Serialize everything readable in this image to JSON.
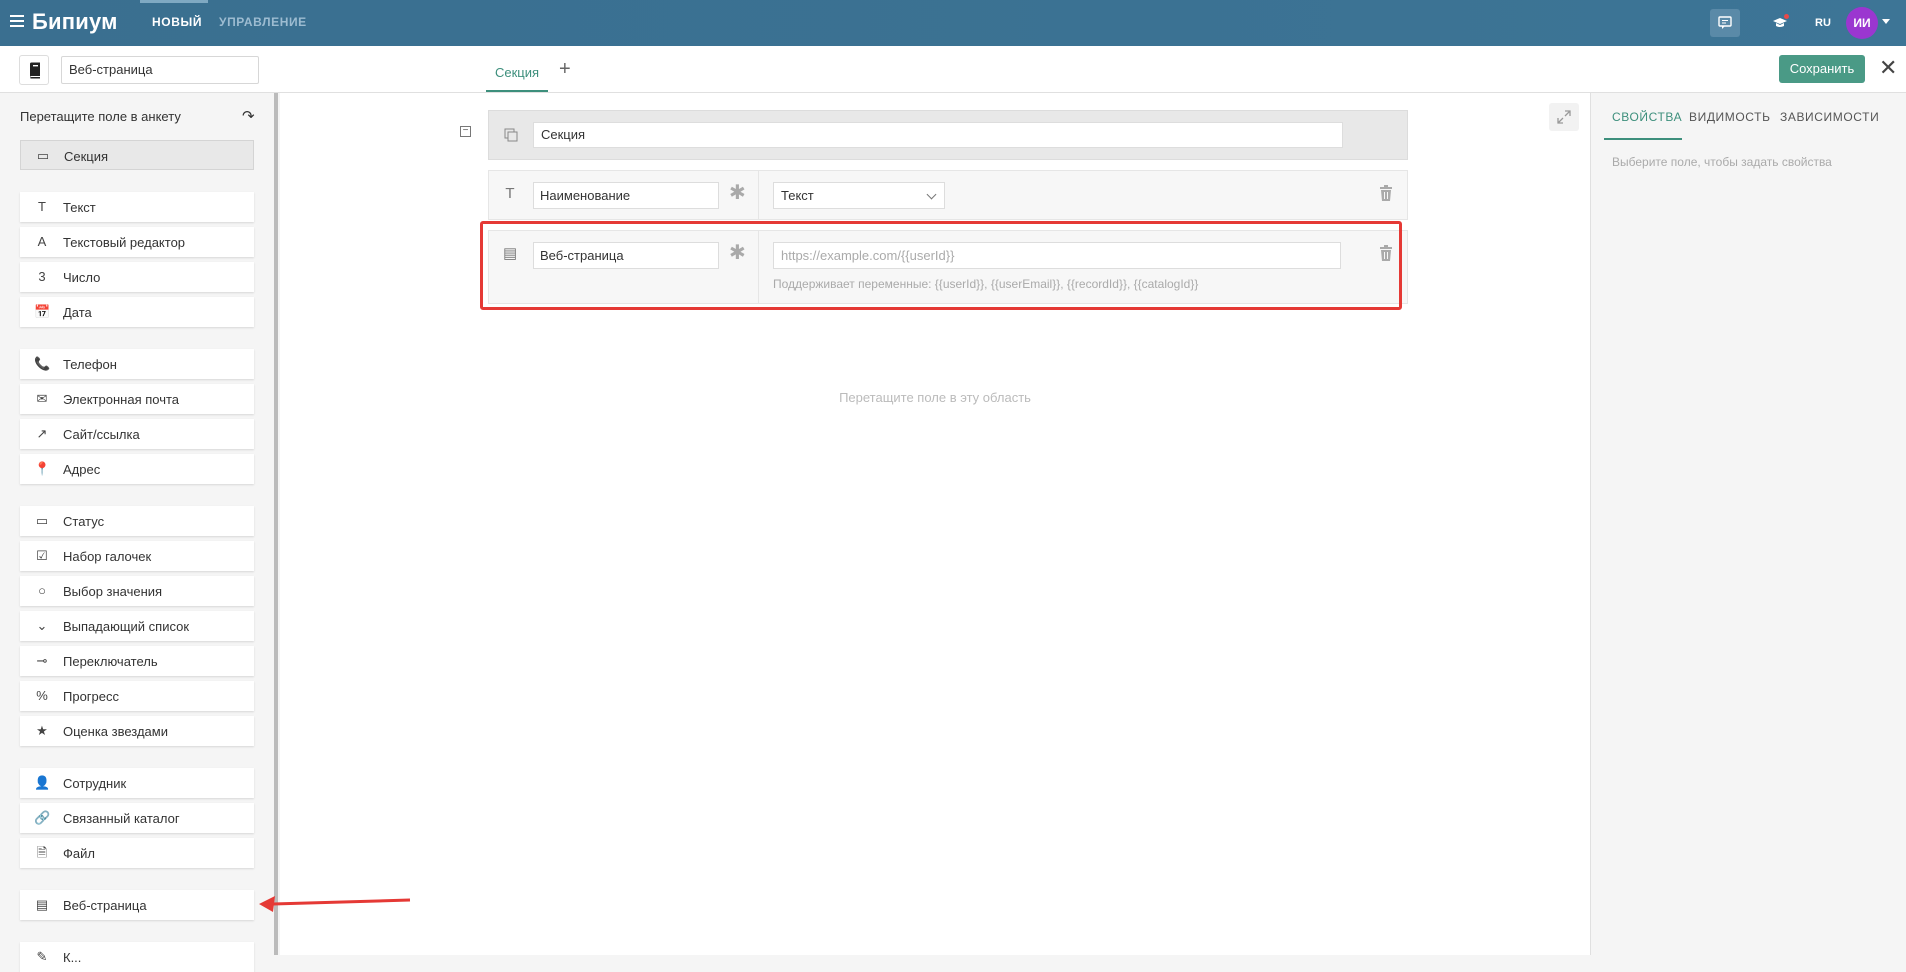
{
  "app": {
    "brand": "Бипиум",
    "nav": {
      "new": "НОВЫЙ",
      "manage": "УПРАВЛЕНИЕ"
    },
    "lang": "RU",
    "avatar_initials": "ИИ"
  },
  "editor": {
    "title_value": "Веб-страница",
    "tab_label": "Секция",
    "add_tab": "+",
    "save_label": "Сохранить",
    "close_label": "✕"
  },
  "sidebar": {
    "header": "Перетащите поле в анкету",
    "refresh": "↷",
    "section_item": "Секция",
    "groups": [
      [
        {
          "icon": "T",
          "label": "Текст"
        },
        {
          "icon": "A",
          "label": "Текстовый редактор"
        },
        {
          "icon": "3",
          "label": "Число"
        },
        {
          "icon": "📅",
          "label": "Дата"
        }
      ],
      [
        {
          "icon": "📞",
          "label": "Телефон"
        },
        {
          "icon": "✉",
          "label": "Электронная почта"
        },
        {
          "icon": "↗",
          "label": "Сайт/ссылка"
        },
        {
          "icon": "📍",
          "label": "Адрес"
        }
      ],
      [
        {
          "icon": "▭",
          "label": "Статус"
        },
        {
          "icon": "☑",
          "label": "Набор галочек"
        },
        {
          "icon": "○",
          "label": "Выбор значения"
        },
        {
          "icon": "⌄",
          "label": "Выпадающий список"
        },
        {
          "icon": "⊸",
          "label": "Переключатель"
        },
        {
          "icon": "%",
          "label": "Прогресс"
        },
        {
          "icon": "★",
          "label": "Оценка звездами"
        }
      ],
      [
        {
          "icon": "👤",
          "label": "Сотрудник"
        },
        {
          "icon": "🔗",
          "label": "Связанный каталог"
        },
        {
          "icon": "🗎",
          "label": "Файл"
        }
      ],
      [
        {
          "icon": "▤",
          "label": "Веб-страница"
        }
      ],
      [
        {
          "icon": "✎",
          "label": "К..."
        }
      ]
    ]
  },
  "canvas": {
    "section_name": "Секция",
    "rows": [
      {
        "name": "Наименование",
        "type": "Текст"
      },
      {
        "name": "Веб-страница",
        "url_placeholder": "https://example.com/{{userId}}",
        "hint": "Поддерживает переменные: {{userId}}, {{userEmail}}, {{recordId}}, {{catalogId}}"
      }
    ],
    "drop_hint": "Перетащите поле в эту область"
  },
  "properties": {
    "tabs": [
      "СВОЙСТВА",
      "ВИДИМОСТЬ",
      "ЗАВИСИМОСТИ"
    ],
    "hint": "Выберите поле, чтобы задать свойства"
  },
  "colors": {
    "topbar": "#3b7293",
    "accent": "#3d8f7c",
    "save": "#4a9a86",
    "highlight": "#e53935",
    "avatar": "#9b36d0"
  }
}
